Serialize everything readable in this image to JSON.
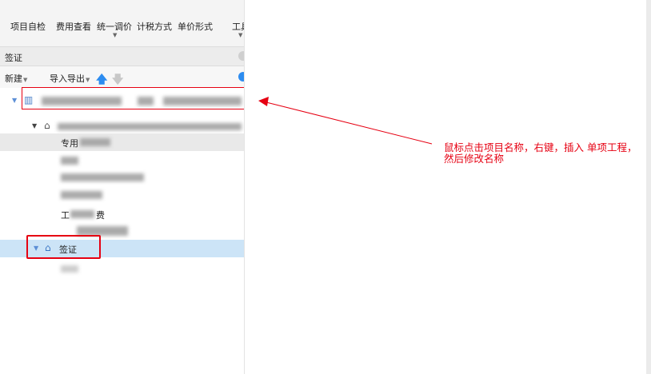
{
  "toolbar": {
    "items": [
      "项目自检",
      "费用查看",
      "统一调价",
      "计税方式",
      "单价形式",
      "工具"
    ]
  },
  "section": {
    "title": "签证"
  },
  "actions": {
    "new_label": "新建",
    "import_export_label": "导入导出"
  },
  "tree": {
    "row4_label": "专用",
    "row_visa_label": "签证",
    "row8_label": "工",
    "row8_suffix": "费"
  },
  "annotation": {
    "text": "鼠标点击项目名称，右键，插入 单项工程，然后修改名称"
  },
  "colors": {
    "annotation": "#e60012",
    "selection": "#cce4f7",
    "accent": "#2d8cf0"
  },
  "icons": [
    "chevron-down-icon",
    "arrow-up-icon",
    "arrow-down-icon",
    "building-icon",
    "home-icon"
  ]
}
